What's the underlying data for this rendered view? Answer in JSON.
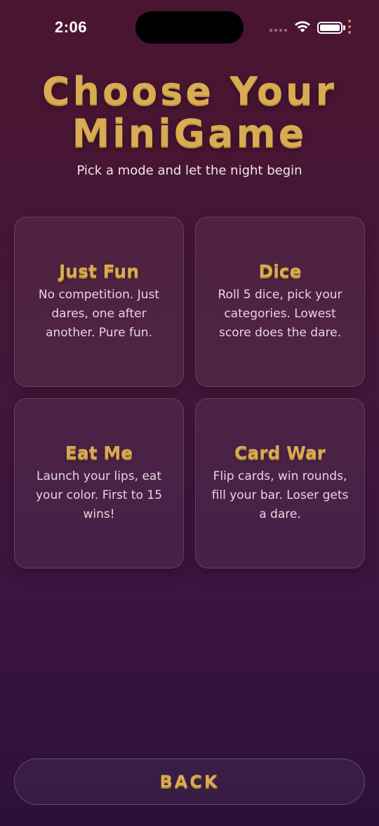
{
  "status_bar": {
    "time": "2:06"
  },
  "header": {
    "title": "Choose Your MiniGame",
    "subtitle": "Pick a mode and let the night begin"
  },
  "modes": [
    {
      "title": "Just Fun",
      "description": "No competition. Just dares, one after another. Pure fun."
    },
    {
      "title": "Dice",
      "description": "Roll 5 dice, pick your categories. Lowest score does the dare."
    },
    {
      "title": "Eat Me",
      "description": "Launch your lips, eat your color. First to 15 wins!"
    },
    {
      "title": "Card War",
      "description": "Flip cards, win rounds, fill your bar. Loser gets a dare."
    }
  ],
  "footer": {
    "back_label": "BACK"
  },
  "colors": {
    "accent_gold": "#d9ab52",
    "background_top": "#4a1530",
    "background_bottom": "#2c1038"
  }
}
